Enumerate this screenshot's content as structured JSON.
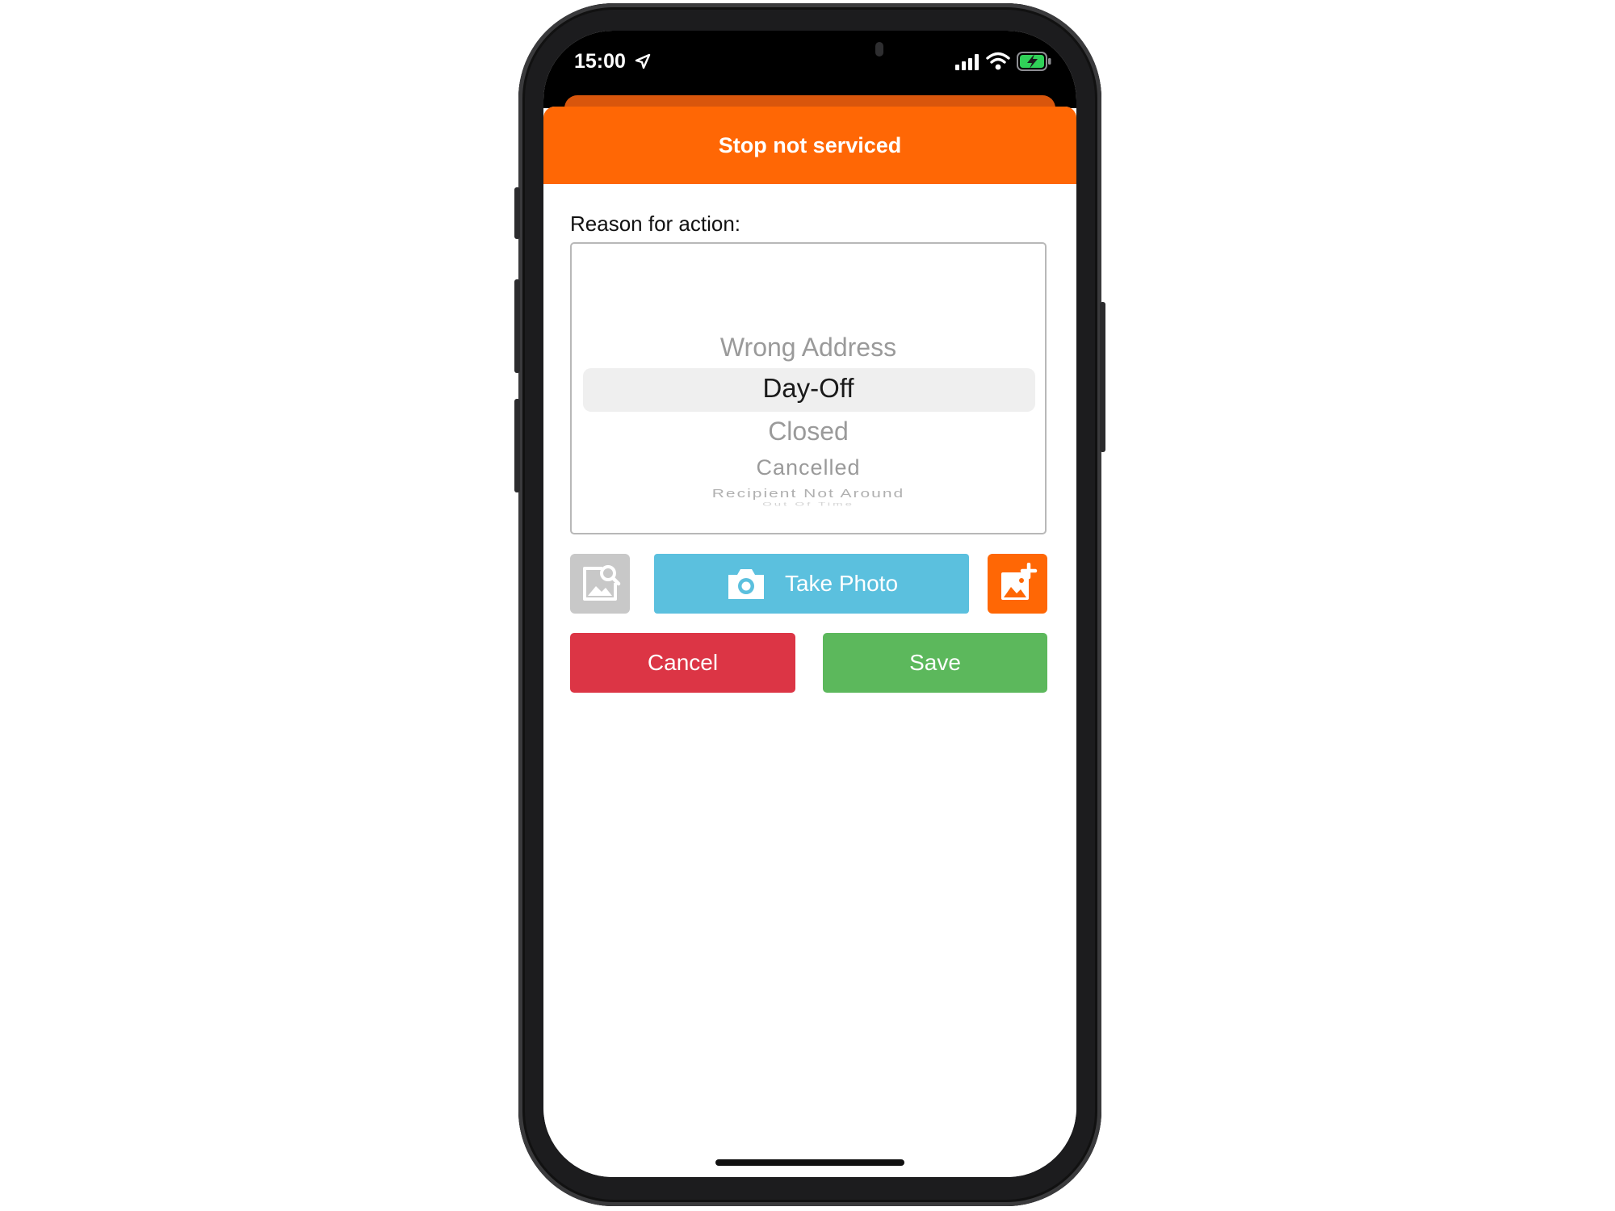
{
  "status_bar": {
    "time": "15:00",
    "icons": [
      "location-arrow-icon",
      "signal-bars-icon",
      "wifi-icon",
      "battery-charging-icon"
    ],
    "battery_color": "#30d158"
  },
  "dialog": {
    "title": "Stop not serviced",
    "header_color": "#ff6705"
  },
  "reason": {
    "label": "Reason for action:",
    "options": [
      "Wrong Address",
      "Day-Off",
      "Closed",
      "Cancelled",
      "Recipient Not Around",
      "Out Of Time"
    ],
    "selected": "Day-Off"
  },
  "photo_actions": {
    "view_photos_icon": "image-search-icon",
    "take_photo_label": "Take Photo",
    "take_photo_icon": "camera-icon",
    "add_photo_icon": "add-image-icon",
    "take_photo_color": "#5bc0de"
  },
  "actions": {
    "cancel_label": "Cancel",
    "save_label": "Save",
    "cancel_color": "#dc3545",
    "save_color": "#5cb85c"
  }
}
